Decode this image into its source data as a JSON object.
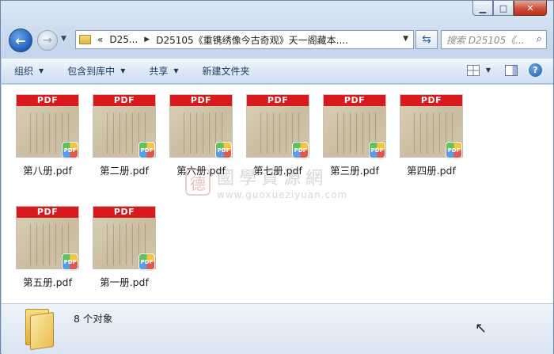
{
  "window": {
    "minimize": "▁",
    "maximize": "□",
    "close": "✕"
  },
  "nav": {
    "back_icon": "back-arrow-icon",
    "forward_icon": "forward-arrow-icon"
  },
  "address": {
    "overflow": "«",
    "crumb_parent": "D25...",
    "crumb_current": "D25105《重镌绣像今古奇观》天一阁藏本...."
  },
  "search": {
    "placeholder": "搜索 D25105《..."
  },
  "toolbar": {
    "organize": "组织",
    "include_library": "包含到库中",
    "share": "共享",
    "new_folder": "新建文件夹"
  },
  "files": [
    {
      "name": "第八册.pdf",
      "badge": "PDF"
    },
    {
      "name": "第二册.pdf",
      "badge": "PDF"
    },
    {
      "name": "第六册.pdf",
      "badge": "PDF"
    },
    {
      "name": "第七册.pdf",
      "badge": "PDF"
    },
    {
      "name": "第三册.pdf",
      "badge": "PDF"
    },
    {
      "name": "第四册.pdf",
      "badge": "PDF"
    },
    {
      "name": "第五册.pdf",
      "badge": "PDF"
    },
    {
      "name": "第一册.pdf",
      "badge": "PDF"
    }
  ],
  "watermark": {
    "seal": "德",
    "cn": "國學資源網",
    "url": "www.guoxueziyuan.com"
  },
  "status": {
    "count": "8 个对象"
  },
  "colors": {
    "pdf_red": "#d8191e",
    "toolbar_text": "#1e395b"
  }
}
